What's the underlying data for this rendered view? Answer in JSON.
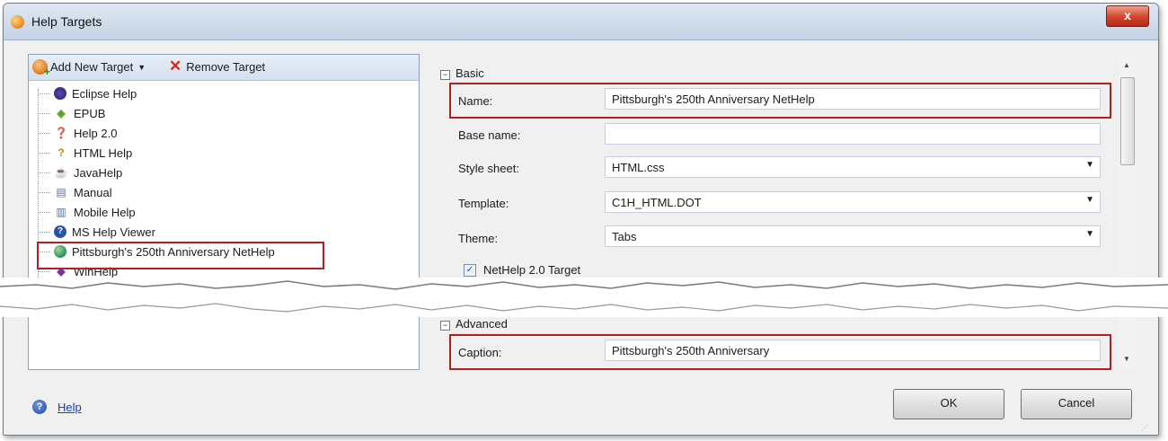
{
  "window": {
    "title": "Help Targets",
    "close_label": "x"
  },
  "toolbar": {
    "add_label": "Add New Target",
    "remove_label": "Remove Target"
  },
  "targets": [
    {
      "label": "Eclipse Help",
      "icon": "eclipse-icon"
    },
    {
      "label": "EPUB",
      "icon": "epub-icon"
    },
    {
      "label": "Help 2.0",
      "icon": "help2-icon"
    },
    {
      "label": "HTML Help",
      "icon": "html-help-icon"
    },
    {
      "label": "JavaHelp",
      "icon": "java-icon"
    },
    {
      "label": "Manual",
      "icon": "manual-icon"
    },
    {
      "label": "Mobile Help",
      "icon": "mobile-icon"
    },
    {
      "label": "MS Help Viewer",
      "icon": "ms-help-viewer-icon"
    },
    {
      "label": "Pittsburgh's 250th Anniversary NetHelp",
      "icon": "nethelp-globe-icon",
      "selected": true
    },
    {
      "label": "WinHelp",
      "icon": "winhelp-icon"
    }
  ],
  "basic": {
    "section_title": "Basic",
    "name_label": "Name:",
    "name_value": "Pittsburgh's 250th Anniversary NetHelp",
    "base_name_label": "Base name:",
    "base_name_value": "",
    "style_sheet_label": "Style sheet:",
    "style_sheet_value": "HTML.css",
    "template_label": "Template:",
    "template_value": "C1H_HTML.DOT",
    "theme_label": "Theme:",
    "theme_value": "Tabs",
    "nethelp20_label": "NetHelp 2.0 Target",
    "nethelp20_checked": true
  },
  "advanced": {
    "section_title": "Advanced",
    "caption_label": "Caption:",
    "caption_value": "Pittsburgh's 250th Anniversary"
  },
  "footer": {
    "help_label": "Help",
    "ok_label": "OK",
    "cancel_label": "Cancel"
  },
  "colors": {
    "highlight": "#b41f1f",
    "link": "#0a43c6"
  }
}
